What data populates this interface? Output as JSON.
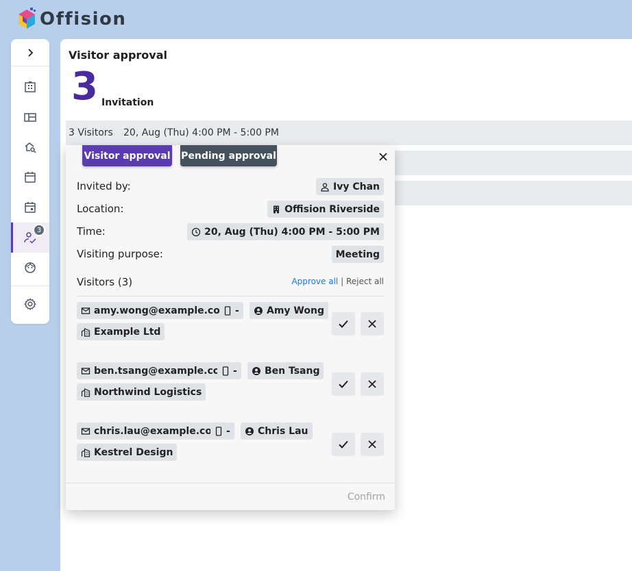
{
  "app": {
    "name": "Offision"
  },
  "sidebar": {
    "expand_icon": "chevron-right-icon",
    "items": [
      {
        "name": "building-icon"
      },
      {
        "name": "floorplan-icon"
      },
      {
        "name": "search-desk-icon"
      },
      {
        "name": "calendar-icon"
      },
      {
        "name": "calendar-event-icon"
      },
      {
        "name": "visitor-approval-icon",
        "badge": "3",
        "active": true
      },
      {
        "name": "face-icon"
      },
      {
        "name": "settings-icon"
      }
    ]
  },
  "main": {
    "title": "Visitor approval",
    "count": "3",
    "count_label": "Invitation",
    "rows": [
      {
        "visitors": "3 Visitors",
        "time": "20, Aug (Thu) 4:00 PM - 5:00 PM"
      },
      {
        "visitors": "",
        "time": ""
      },
      {
        "visitors": "",
        "time": ""
      }
    ]
  },
  "popup": {
    "tab_approval": "Visitor approval",
    "tab_pending": "Pending approval",
    "invited_by_label": "Invited by:",
    "invited_by": "Ivy Chan",
    "location_label": "Location:",
    "location": "Offision Riverside",
    "time_label": "Time:",
    "time": "20, Aug (Thu) 4:00 PM - 5:00 PM",
    "purpose_label": "Visiting purpose:",
    "purpose": "Meeting",
    "visitors_title": "Visitors (3)",
    "approve_all": "Approve all",
    "separator": "|",
    "reject_all": "Reject all",
    "confirm": "Confirm",
    "visitors": [
      {
        "email": "amy.wong@example.com",
        "phone": "-",
        "name": "Amy Wong",
        "company": "Example Ltd"
      },
      {
        "email": "ben.tsang@example.com",
        "phone": "-",
        "name": "Ben Tsang",
        "company": "Northwind Logistics"
      },
      {
        "email": "chris.lau@example.com",
        "phone": "-",
        "name": "Chris Lau",
        "company": "Kestrel Design"
      }
    ]
  },
  "colors": {
    "accent": "#5b3bb0",
    "pending": "#45525e",
    "background": "#b7cfea",
    "link": "#1f7ae0"
  }
}
